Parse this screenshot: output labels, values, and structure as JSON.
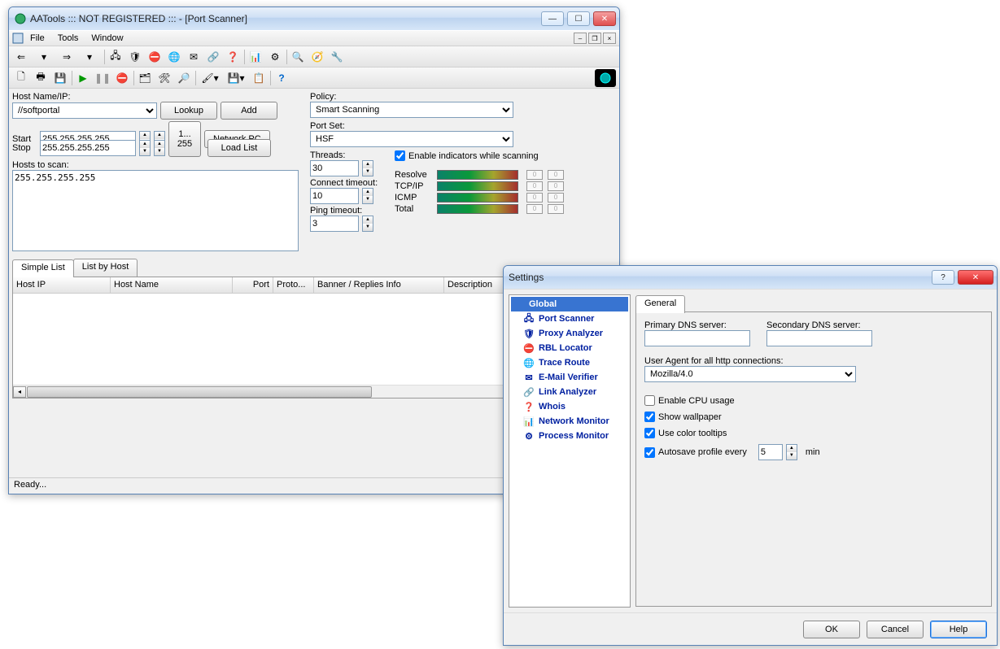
{
  "main": {
    "title": "AATools ::: NOT REGISTERED ::: - [Port Scanner]",
    "menu": {
      "file": "File",
      "tools": "Tools",
      "window": "Window"
    },
    "host_label": "Host Name/IP:",
    "host_value": "//softportal",
    "lookup": "Lookup",
    "add": "Add",
    "start_label": "Start",
    "start_ip": "255.255.255.255",
    "stop_label": "Stop",
    "stop_ip": "255.255.255.255",
    "range_btn": "1...\n255",
    "network_pc": "Network PC",
    "load_list": "Load List",
    "hosts_label": "Hosts to scan:",
    "hosts_text": "255.255.255.255",
    "policy_label": "Policy:",
    "policy_value": "Smart Scanning",
    "portset_label": "Port Set:",
    "portset_value": "HSF",
    "threads_label": "Threads:",
    "threads_value": "30",
    "enable_ind": "Enable indicators while scanning",
    "ctimeout_label": "Connect timeout:",
    "ctimeout_value": "10",
    "ptimeout_label": "Ping timeout:",
    "ptimeout_value": "3",
    "ind": {
      "resolve": "Resolve",
      "tcpip": "TCP/IP",
      "icmp": "ICMP",
      "total": "Total"
    },
    "tabs": {
      "simple": "Simple List",
      "byhost": "List by Host"
    },
    "cols": {
      "hostip": "Host IP",
      "hostname": "Host Name",
      "port": "Port",
      "proto": "Proto...",
      "banner": "Banner / Replies Info",
      "desc": "Description"
    },
    "status": "Ready..."
  },
  "dlg": {
    "title": "Settings",
    "tree": [
      {
        "label": "Global",
        "sel": true
      },
      {
        "label": "Port Scanner"
      },
      {
        "label": "Proxy Analyzer"
      },
      {
        "label": "RBL Locator"
      },
      {
        "label": "Trace Route"
      },
      {
        "label": "E-Mail Verifier"
      },
      {
        "label": "Link Analyzer"
      },
      {
        "label": "Whois"
      },
      {
        "label": "Network Monitor"
      },
      {
        "label": "Process Monitor"
      }
    ],
    "tab_general": "General",
    "primary_dns": "Primary DNS server:",
    "secondary_dns": "Secondary DNS server:",
    "useragent_label": "User Agent for all http connections:",
    "useragent_value": "Mozilla/4.0",
    "cpu": "Enable CPU usage",
    "wallpaper": "Show wallpaper",
    "tooltips": "Use color tooltips",
    "autosave": "Autosave profile every",
    "autosave_val": "5",
    "autosave_unit": "min",
    "ok": "OK",
    "cancel": "Cancel",
    "help": "Help"
  }
}
